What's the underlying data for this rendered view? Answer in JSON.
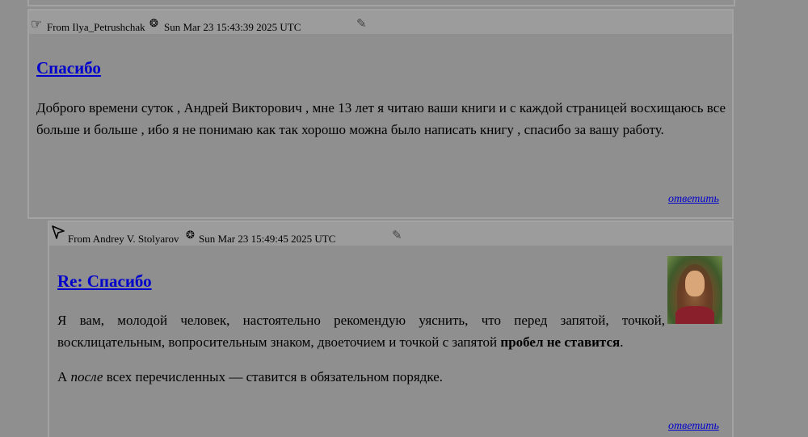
{
  "posts": [
    {
      "hand_icon": "☞",
      "author": "From Ilya_Petrushchak",
      "seal_icon": "seal-icon",
      "date": "Sun Mar 23 15:43:39 2025 UTC",
      "edit_icon": "pencil-icon",
      "title": "Спасибо",
      "body": "Доброго времени суток , Андрей Викторович , мне 13 лет я читаю ваши книги и с каждой страницей восхищаюсь все больше и больше , ибо я не понимаю как так хорошо можна было написать книгу , спасибо за вашу работу.",
      "reply_label": "ответить"
    },
    {
      "hand_icon": "cursor-arrow-icon",
      "author": "From Andrey V. Stolyarov",
      "seal_icon": "seal-icon",
      "date": "Sun Mar 23 15:49:45 2025 UTC",
      "edit_icon": "pencil-icon",
      "title": "Re: Спасибо",
      "body_p1_start": "Я вам, молодой человек, настоятельно рекомендую уяснить, что перед запятой, точкой, восклицательным, вопросительным знаком, двоеточием и точкой с запятой ",
      "body_p1_bold": "пробел не ставится",
      "body_p1_end": ".",
      "body_p2_start": "А ",
      "body_p2_italic": "после",
      "body_p2_end": " всех перечисленных — ставится в обязательном порядке.",
      "reply_label": "ответить",
      "avatar": "author-avatar"
    }
  ]
}
